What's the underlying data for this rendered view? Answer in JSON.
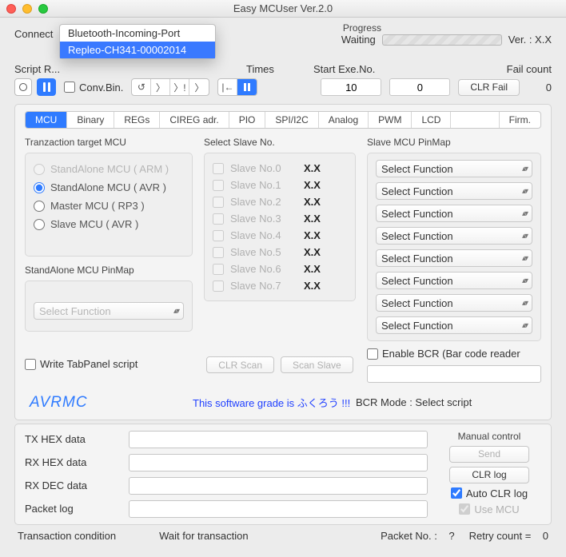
{
  "window": {
    "title": "Easy MCUser Ver.2.0"
  },
  "toprow": {
    "connect_label": "Connect",
    "progress_label": "Progress",
    "progress_status": "Waiting",
    "version": "Ver. : X.X"
  },
  "dropdown": {
    "opt0": "Bluetooth-Incoming-Port",
    "opt1": "Repleo-CH341-00002014"
  },
  "scriptrow": {
    "label": "Script R...",
    "conv_bin": "Conv.Bin.",
    "times_label": "Times",
    "startexe_label": "Start Exe.No.",
    "failcount_label": "Fail count",
    "times_value": "10",
    "startexe_value": "0",
    "clr_fail": "CLR Fail",
    "failcount_value": "0",
    "seg": {
      "a": "↺",
      "b": "〉",
      "c": "〉!",
      "d": "〉",
      "e": "|←"
    }
  },
  "tabs": {
    "mcu": "MCU",
    "binary": "Binary",
    "regs": "REGs",
    "cireg": "CIREG adr.",
    "pio": "PIO",
    "spi": "SPI/I2C",
    "analog": "Analog",
    "pwm": "PWM",
    "lcd": "LCD",
    "firm": "Firm."
  },
  "colA": {
    "title": "Tranzaction target MCU",
    "r0": "StandAlone MCU ( ARM )",
    "r1": "StandAlone MCU ( AVR )",
    "r2": "Master MCU ( RP3 )",
    "r3": "Slave MCU ( AVR )",
    "pinmap_title": "StandAlone MCU PinMap",
    "select_fn": "Select Function"
  },
  "colB": {
    "title": "Select Slave No.",
    "rows": [
      {
        "label": "Slave No.0",
        "v": "X.X"
      },
      {
        "label": "Slave No.1",
        "v": "X.X"
      },
      {
        "label": "Slave No.2",
        "v": "X.X"
      },
      {
        "label": "Slave No.3",
        "v": "X.X"
      },
      {
        "label": "Slave No.4",
        "v": "X.X"
      },
      {
        "label": "Slave No.5",
        "v": "X.X"
      },
      {
        "label": "Slave No.6",
        "v": "X.X"
      },
      {
        "label": "Slave No.7",
        "v": "X.X"
      }
    ],
    "clr_scan": "CLR Scan",
    "scan_slave": "Scan Slave"
  },
  "colC": {
    "title": "Slave MCU PinMap",
    "select_fn": "Select Function",
    "enable_bcr": "Enable BCR (Bar code reader",
    "bcr_mode": "BCR Mode : Select script"
  },
  "under": {
    "write_tab": "Write TabPanel script",
    "avrmc": "AVRMC",
    "grade": "This software grade is ふくろう !!!"
  },
  "low": {
    "manual": "Manual control",
    "txhex": "TX HEX data",
    "rxhex": "RX HEX data",
    "rxdec": "RX DEC data",
    "pktlog": "Packet log",
    "send": "Send",
    "clrlog": "CLR log",
    "autoclr": "Auto CLR log",
    "usemcu": "Use MCU"
  },
  "status": {
    "trans_cond": "Transaction condition",
    "wait": "Wait for transaction",
    "pktno_lbl": "Packet No. :",
    "pktno_val": "?",
    "retry_lbl": "Retry count  =",
    "retry_val": "0"
  }
}
